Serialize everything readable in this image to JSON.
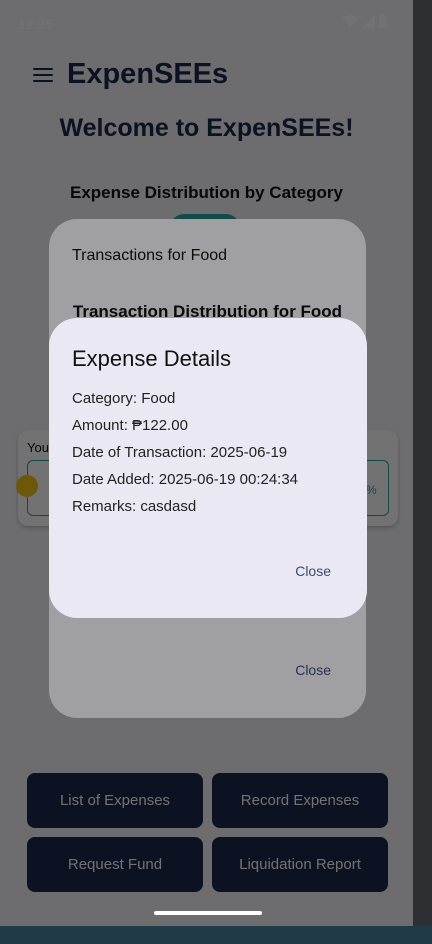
{
  "status_bar": {
    "time": "12:25"
  },
  "app_bar": {
    "title": "ExpenSEEs"
  },
  "home": {
    "welcome": "Welcome to ExpenSEEs!",
    "distribution_title": "Expense Distribution by Category",
    "budget_label_partial": "You",
    "budget_percent_partial": "%"
  },
  "buttons": {
    "list": "List of Expenses",
    "record": "Record Expenses",
    "request": "Request Fund",
    "liquidation": "Liquidation Report"
  },
  "transactions_dialog": {
    "title": "Transactions for Food",
    "subtitle": "Transaction Distribution for Food",
    "close": "Close"
  },
  "details_dialog": {
    "title": "Expense Details",
    "category": "Category: Food",
    "amount": "Amount: ₱122.00",
    "date_transaction": "Date of Transaction: 2025-06-19",
    "date_added": "Date Added: 2025-06-19 00:24:34",
    "remarks": "Remarks: casdasd",
    "close": "Close"
  },
  "icons": [
    "menu-icon",
    "wifi-icon",
    "signal-icon",
    "battery-icon",
    "coin-icon"
  ],
  "colors": {
    "primary": "#1d2a4e",
    "accent": "#2aa8a8",
    "coin": "#f2c21b",
    "dialog_bg": "#e9e8f3"
  }
}
